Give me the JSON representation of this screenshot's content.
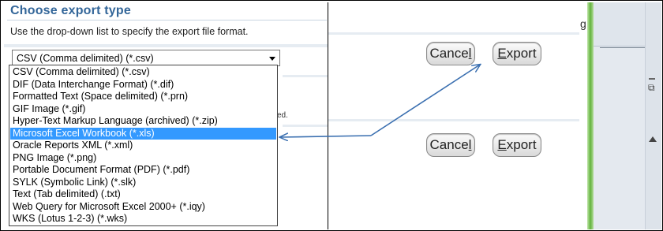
{
  "dialog": {
    "title": "Choose export type",
    "description": "Use the drop-down list to specify the export file format.",
    "partial_text": "ed."
  },
  "select": {
    "value": "CSV (Comma delimited) (*.csv)"
  },
  "options": [
    "CSV (Comma delimited) (*.csv)",
    "DIF (Data Interchange Format) (*.dif)",
    "Formatted Text (Space delimited) (*.prn)",
    "GIF Image (*.gif)",
    "Hyper-Text Markup Language (archived) (*.zip)",
    "Microsoft Excel Workbook (*.xls)",
    "Oracle Reports XML (*.xml)",
    "PNG Image (*.png)",
    "Portable Document Format (PDF) (*.pdf)",
    "SYLK (Symbolic Link) (*.slk)",
    "Text (Tab delimited) (.txt)",
    "Web Query for Microsoft Excel 2000+ (*.iqy)",
    "WKS (Lotus 1-2-3) (*.wks)"
  ],
  "selected_index": 5,
  "buttons": {
    "cancel_label": "Cancel",
    "export_label": "Export"
  },
  "chrome": {
    "partial_g": "g"
  },
  "colors": {
    "title": "#336699",
    "selection": "#3399ff",
    "arrow": "#3a6fb0",
    "green_bar": "#62b33d"
  }
}
